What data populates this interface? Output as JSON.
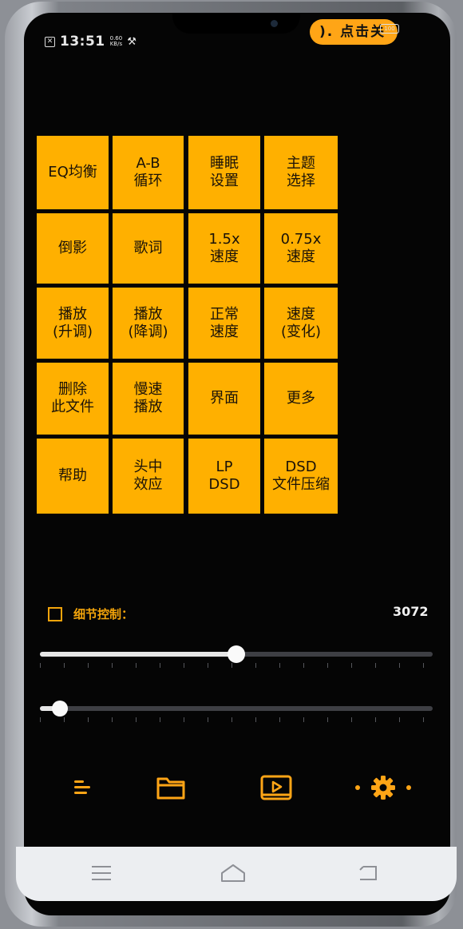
{
  "status_bar": {
    "notification_icon": "x-box-icon",
    "time": "13:51",
    "network_speed": "0.60\nKB/s",
    "tools_icon": "tools-icon",
    "battery": "100"
  },
  "notification_pill": {
    "text": "). 点击关"
  },
  "feature_grid": {
    "tiles": [
      "EQ均衡",
      "A-B\n循环",
      "睡眠\n设置",
      "主题\n选择",
      "倒影",
      "歌词",
      "1.5x\n速度",
      "0.75x\n速度",
      "播放\n(升调)",
      "播放\n(降调)",
      "正常\n速度",
      "速度\n(变化)",
      "删除\n此文件",
      "慢速\n播放",
      "界面",
      "更多",
      "帮助",
      "头中\n效应",
      "LP\nDSD",
      "DSD\n文件压缩"
    ]
  },
  "detail_control": {
    "label": "细节控制：",
    "value": "3072",
    "checked": false
  },
  "sliders": {
    "primary_fraction": 0.5,
    "secondary_fraction": 0.05
  },
  "toolbar": {
    "icons": [
      "menu-icon",
      "folder-icon",
      "play-video-icon",
      "settings-gear-icon"
    ]
  },
  "navigation": {
    "buttons": [
      "recent-apps-icon",
      "home-icon",
      "back-icon"
    ]
  },
  "colors": {
    "accent": "#ffb000",
    "accent_text": "#f3a40b",
    "background": "#050505"
  }
}
